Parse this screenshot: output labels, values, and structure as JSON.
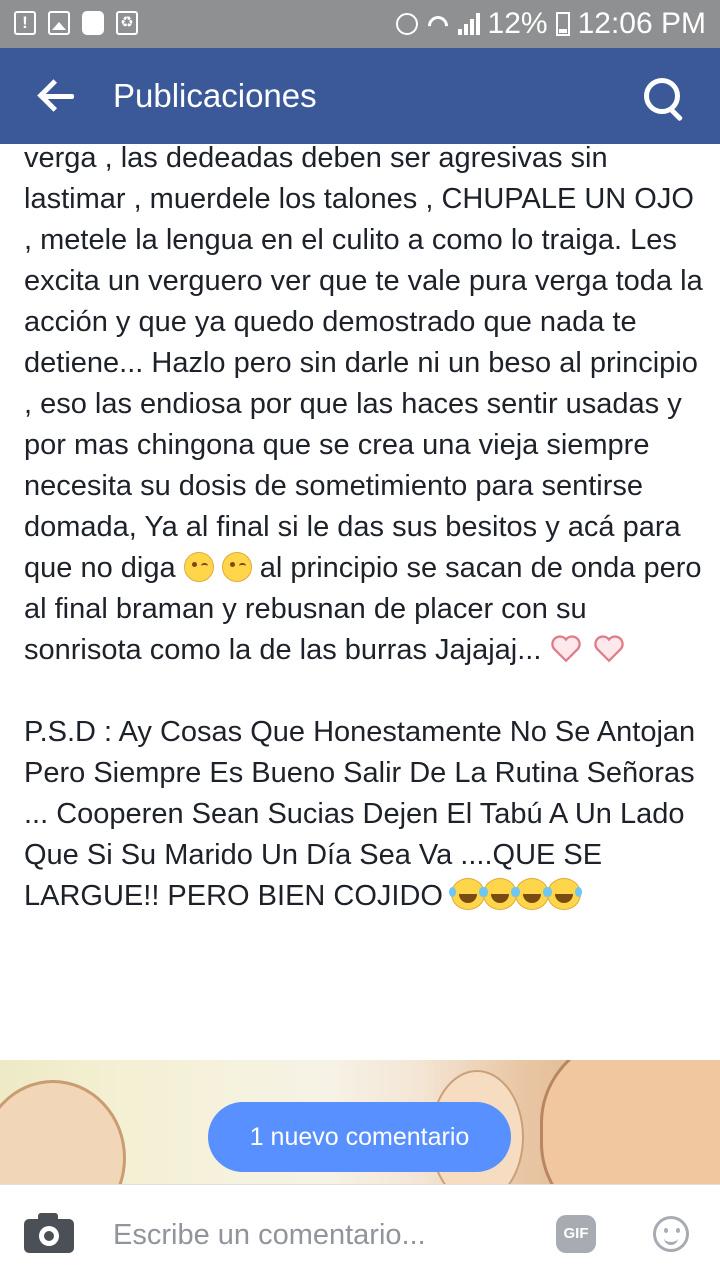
{
  "status_bar": {
    "battery": "12%",
    "time": "12:06 PM",
    "icons": [
      "alert-icon",
      "image-icon",
      "globe-icon",
      "recycle-icon",
      "alarm-icon",
      "wifi-icon",
      "signal-icon",
      "battery-icon"
    ]
  },
  "header": {
    "title": "Publicaciones",
    "back_icon": "arrow-left-icon",
    "search_icon": "search-icon",
    "color": "#3b5998"
  },
  "post": {
    "paragraph1": "verga , las dedeadas deben ser agresivas sin lastimar , muerdele los talones , CHUPALE UN OJO , metele la lengua en el culito a como lo traiga. Les excita un verguero ver que te vale pura verga toda la acción y que ya quedo demostrado que nada te detiene... Hazlo pero sin darle ni un beso al principio , eso las endiosa por que las haces sentir usadas y por mas chingona que se crea una vieja siempre necesita su dosis de sometimiento para sentirse domada, Ya al final si le das sus besitos y acá para que no diga",
    "paragraph1_mid": "al principio se sacan de onda pero al final braman y rebusnan de placer con su sonrisota como la de las burras Jajajaj...",
    "paragraph2": "P.S.D : Ay Cosas Que Honestamente No Se Antojan Pero Siempre Es Bueno Salir De La Rutina Señoras ... Cooperen Sean Sucias Dejen El Tabú A Un Lado Que Si Su Marido Un Día Sea Va ....QUE SE LARGUE!! PERO BIEN COJIDO"
  },
  "new_comment_pill": {
    "label": "1 nuevo comentario",
    "color": "#5890ff"
  },
  "comment_bar": {
    "placeholder": "Escribe un comentario...",
    "gif_label": "GIF"
  }
}
